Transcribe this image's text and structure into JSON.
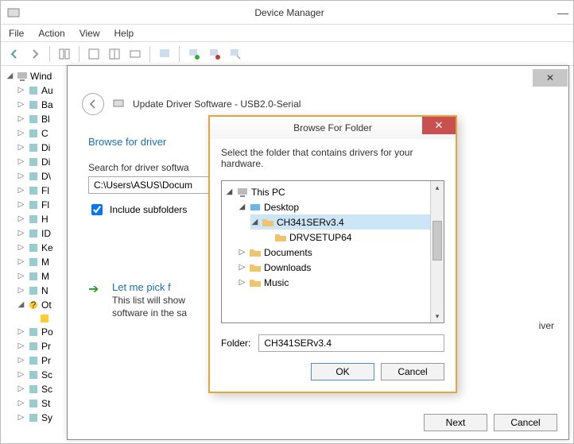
{
  "dm": {
    "title": "Device Manager",
    "menu": {
      "file": "File",
      "action": "Action",
      "view": "View",
      "help": "Help"
    },
    "tree_root": "Wind",
    "tree_items": [
      "Au",
      "Ba",
      "Bl",
      "C",
      "Di",
      "Di",
      "D\\",
      "Fl",
      "Fl",
      "H",
      "ID",
      "Ke",
      "M",
      "M",
      "N"
    ],
    "tree_other": "Ot",
    "tree_other_child": "",
    "tree_tail": [
      "Po",
      "Pr",
      "Pr",
      "Sc",
      "Sc",
      "St",
      "Sy"
    ]
  },
  "upd": {
    "title": "Update Driver Software - USB2.0-Serial",
    "section": "Browse for driver",
    "search_label": "Search for driver softwa",
    "path": "C:\\Users\\ASUS\\Docum",
    "include": "Include subfolders",
    "pick_title": "Let me pick f",
    "pick_desc1": "This list will show",
    "pick_desc2": "software in the sa",
    "pick_desc_suffix": "iver",
    "next": "Next",
    "cancel": "Cancel"
  },
  "bff": {
    "title": "Browse For Folder",
    "instruction": "Select the folder that contains drivers for your hardware.",
    "items": {
      "this_pc": "This PC",
      "desktop": "Desktop",
      "ch341": "CH341SERv3.4",
      "drvsetup": "DRVSETUP64",
      "documents": "Documents",
      "downloads": "Downloads",
      "music": "Music"
    },
    "folder_label": "Folder:",
    "folder_value": "CH341SERv3.4",
    "ok": "OK",
    "cancel": "Cancel"
  }
}
